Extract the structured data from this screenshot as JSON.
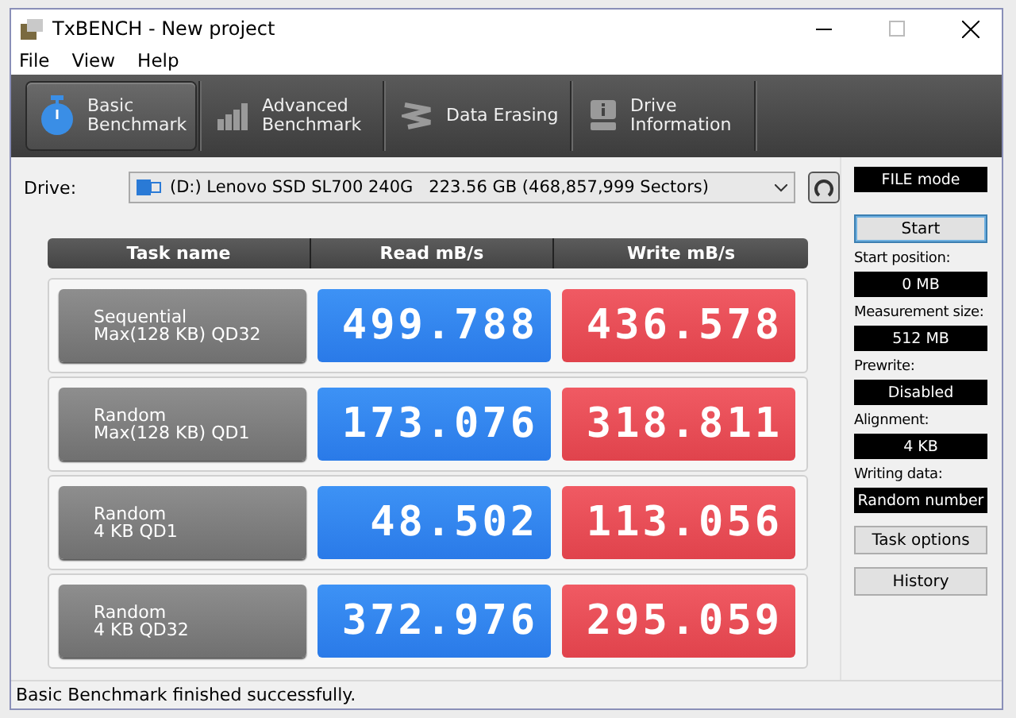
{
  "window": {
    "title": "TxBENCH - New project"
  },
  "menu": [
    "File",
    "View",
    "Help"
  ],
  "tabs": [
    {
      "lines": [
        "Basic",
        "Benchmark"
      ],
      "selected": true
    },
    {
      "lines": [
        "Advanced",
        "Benchmark"
      ],
      "selected": false
    },
    {
      "lines": [
        "Data Erasing"
      ],
      "selected": false
    },
    {
      "lines": [
        "Drive",
        "Information"
      ],
      "selected": false
    }
  ],
  "drive": {
    "label": "Drive:",
    "value": "(D:) Lenovo SSD SL700 240G   223.56 GB (468,857,999 Sectors)"
  },
  "mode": "FILE mode",
  "table": {
    "columns": [
      "Task name",
      "Read mB/s",
      "Write mB/s"
    ],
    "rows": [
      {
        "task": [
          "Sequential",
          "Max(128 KB) QD32"
        ],
        "read": "499.788",
        "write": "436.578"
      },
      {
        "task": [
          "Random",
          "Max(128 KB) QD1"
        ],
        "read": "173.076",
        "write": "318.811"
      },
      {
        "task": [
          "Random",
          "4 KB QD1"
        ],
        "read": "48.502",
        "write": "113.056"
      },
      {
        "task": [
          "Random",
          "4 KB QD32"
        ],
        "read": "372.976",
        "write": "295.059"
      }
    ]
  },
  "start_button": "Start",
  "settings": [
    {
      "label": "Start position:",
      "value": "0 MB"
    },
    {
      "label": "Measurement size:",
      "value": "512 MB"
    },
    {
      "label": "Prewrite:",
      "value": "Disabled"
    },
    {
      "label": "Alignment:",
      "value": "4 KB"
    },
    {
      "label": "Writing data:",
      "value": "Random number"
    }
  ],
  "buttons": [
    "Task options",
    "History"
  ],
  "status_bar": "Basic Benchmark finished successfully."
}
